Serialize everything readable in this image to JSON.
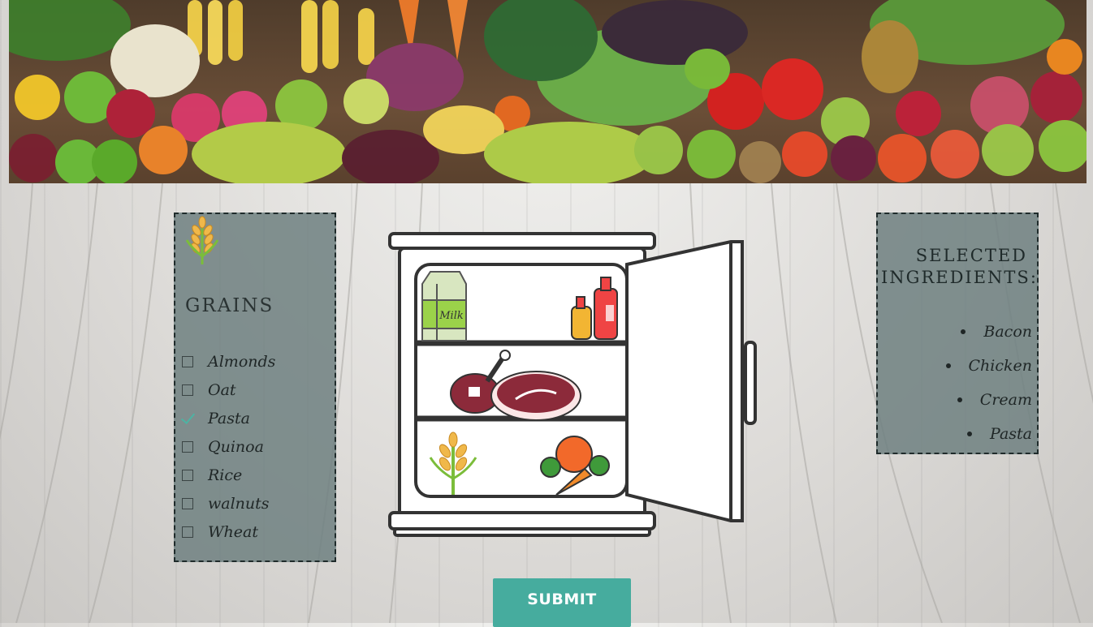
{
  "category": {
    "icon": "wheat-icon",
    "title": "GRAINS",
    "items": [
      {
        "label": "Almonds",
        "checked": false
      },
      {
        "label": "Oat",
        "checked": false
      },
      {
        "label": "Pasta",
        "checked": true
      },
      {
        "label": "Quinoa",
        "checked": false
      },
      {
        "label": "Rice",
        "checked": false
      },
      {
        "label": "walnuts",
        "checked": false
      },
      {
        "label": "Wheat",
        "checked": false
      }
    ]
  },
  "fridge": {
    "milk_label": "Milk",
    "icons": [
      "milk-carton-icon",
      "sauce-bottles-icon",
      "meat-icon",
      "steak-icon",
      "wheat-icon",
      "vegetables-icon"
    ]
  },
  "selected": {
    "title_line1": "SELECTED",
    "title_line2": "INGREDIENTS:",
    "items": [
      "Bacon",
      "Chicken",
      "Cream",
      "Pasta"
    ]
  },
  "submit": {
    "label": "SUBMIT"
  },
  "colors": {
    "accent": "#46ac9e",
    "panel": "#6e8080",
    "check": "#4db3a3"
  }
}
